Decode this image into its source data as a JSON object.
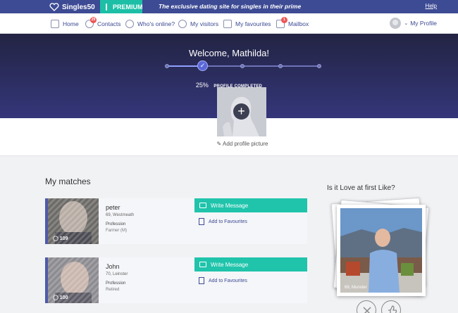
{
  "topbar": {
    "brand": "Singles50",
    "premium_label": "PREMIUM",
    "tagline": "The exclusive dating site for singles in their prime",
    "help_label": "Help"
  },
  "nav": {
    "items": [
      {
        "label": "Home",
        "icon": "home-icon"
      },
      {
        "label": "Contacts",
        "icon": "contacts-icon",
        "badge": "29"
      },
      {
        "label": "Who's online?",
        "icon": "online-icon"
      },
      {
        "label": "My visitors",
        "icon": "visitors-icon"
      },
      {
        "label": "My favourites",
        "icon": "favourites-icon"
      },
      {
        "label": "Mailbox",
        "icon": "mailbox-icon",
        "badge": "1"
      }
    ],
    "profile_label": "My Profile"
  },
  "hero": {
    "welcome": "Welcome, Mathilda!",
    "progress_percent": "25%",
    "progress_label": "PROFILE COMPLETED",
    "progress_fraction": 0.25,
    "add_picture_label": "Add profile picture"
  },
  "matches": {
    "title": "My matches",
    "write_label": "Write Message",
    "fav_label": "Add to Favourites",
    "items": [
      {
        "name": "peter",
        "age_location": "69, Westmeath",
        "profession_label": "Profession",
        "profession": "Farmer (M)",
        "photo_count": "109"
      },
      {
        "name": "John",
        "age_location": "70, Leinster",
        "profession_label": "Profession",
        "profession": "Retired",
        "photo_count": "100"
      }
    ]
  },
  "love": {
    "title": "Is it Love at first Like?",
    "caption": "69, Munster"
  },
  "colors": {
    "brand_navy": "#3d4a94",
    "accent_teal": "#1fc4ab",
    "hero_dark": "#232443"
  }
}
